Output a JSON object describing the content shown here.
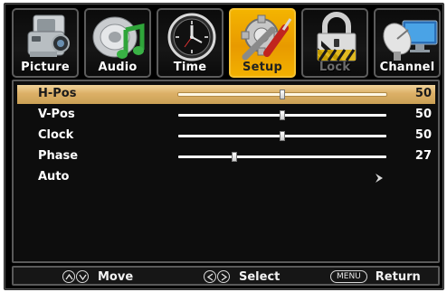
{
  "tabs": [
    {
      "label": "Picture",
      "icon": "camcorder-icon",
      "state": "normal"
    },
    {
      "label": "Audio",
      "icon": "speaker-music-note-icon",
      "state": "normal"
    },
    {
      "label": "Time",
      "icon": "clock-icon",
      "state": "normal"
    },
    {
      "label": "Setup",
      "icon": "tools-gear-icon",
      "state": "active"
    },
    {
      "label": "Lock",
      "icon": "padlock-icon",
      "state": "disabled"
    },
    {
      "label": "Channel",
      "icon": "satellite-dish-icon",
      "state": "normal"
    }
  ],
  "setup": {
    "items": [
      {
        "label": "H-Pos",
        "value": "50",
        "level": 0.5,
        "selected": true
      },
      {
        "label": "V-Pos",
        "value": "50",
        "level": 0.5,
        "selected": false
      },
      {
        "label": "Clock",
        "value": "50",
        "level": 0.5,
        "selected": false
      },
      {
        "label": "Phase",
        "value": "27",
        "level": 0.27,
        "selected": false
      },
      {
        "label": "Auto",
        "submenu": true,
        "selected": false
      }
    ]
  },
  "help": {
    "move_label": "Move",
    "select_label": "Select",
    "menu_key": "MENU",
    "return_label": "Return"
  },
  "colors": {
    "active_tab": "#f0a800",
    "selected_row": "#dcb067",
    "background": "#000000",
    "text": "#ffffff"
  }
}
